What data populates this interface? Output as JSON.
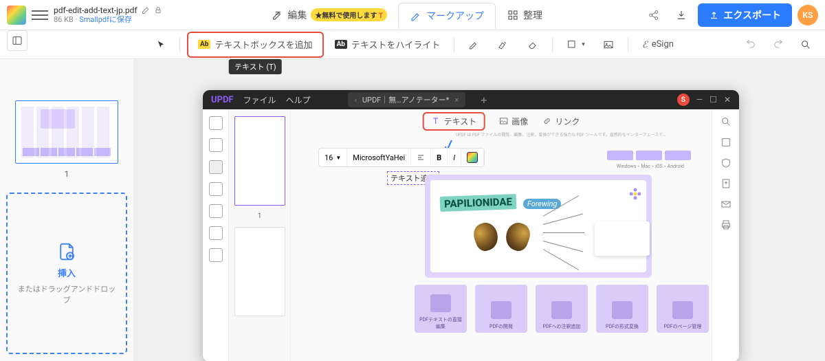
{
  "header": {
    "file_name": "pdf-edit-add-text-jp.pdf",
    "file_size": "86 KB",
    "save_link": "Smallpdfに保存",
    "tabs": {
      "edit": "編集",
      "edit_badge": "★無料で使用します",
      "markup": "マークアップ",
      "organize": "整理"
    },
    "export": "エクスポート",
    "avatar": "KS"
  },
  "toolbar": {
    "add_textbox": "テキストボックスを追加",
    "tooltip": "テキスト (T)",
    "highlight_text": "テキストをハイライト",
    "esign": "eSign"
  },
  "left_panel": {
    "page_num": "1",
    "insert": "挿入",
    "drag_drop": "またはドラッグアンドドロップ"
  },
  "updf": {
    "logo": "UPDF",
    "menu_file": "ファイル",
    "menu_help": "ヘルプ",
    "tab_title": "UPDF｜無…アノテーター*",
    "avatar": "S",
    "tool_text": "テキスト",
    "tool_image": "画像",
    "tool_link": "リンク",
    "font_size": "16",
    "font_name": "MicrosoftYaHei",
    "sample_text": "テキスト追加",
    "thumb1_num": "1",
    "platforms": "Windows・Mac・iOS・Android",
    "butterfly_title": "PAPILIONIDAE",
    "butterfly_sub": "Forewing",
    "cards": [
      "PDFテキストの直接編集",
      "PDFの開発",
      "PDFへの注釈追加",
      "PDFの形式変換",
      "PDFのページ管理"
    ]
  }
}
